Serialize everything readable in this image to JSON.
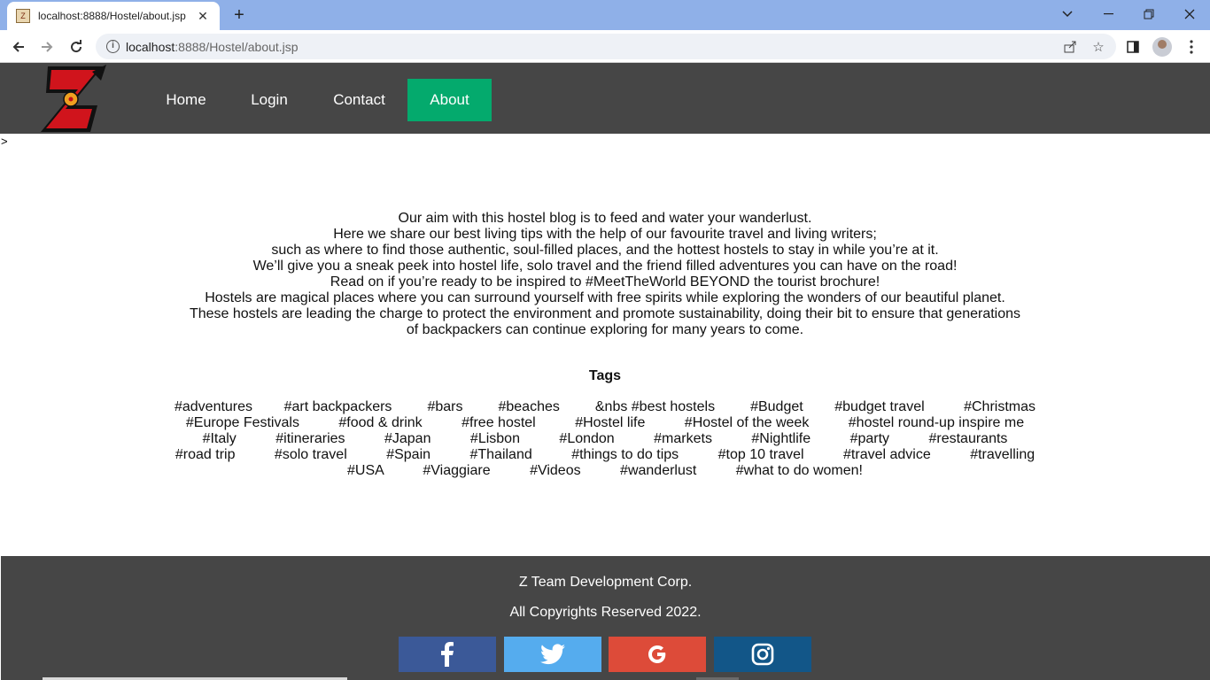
{
  "browser": {
    "tab_title": "localhost:8888/Hostel/about.jsp",
    "url_host": "localhost",
    "url_rest": ":8888/Hostel/about.jsp"
  },
  "site": {
    "nav": [
      {
        "label": "Home"
      },
      {
        "label": "Login"
      },
      {
        "label": "Contact"
      },
      {
        "label": "About",
        "active": true
      }
    ],
    "stray_char": ">"
  },
  "intro": [
    "Our aim with this hostel blog is to feed and water your wanderlust.",
    "Here we share our best living tips with the help of our favourite travel and living writers;",
    "such as where to find those authentic, soul-filled places, and the hottest hostels to stay in while you’re at it.",
    "We’ll give you a sneak peek into hostel life, solo travel and the friend filled adventures you can have on the road!",
    "Read on if you’re ready to be inspired to #MeetTheWorld BEYOND the tourist brochure!",
    "Hostels are magical places where you can surround yourself with free spirits while exploring the wonders of our beautiful planet.",
    "These hostels are leading the charge to protect the environment and promote sustainability, doing their bit to ensure that generations",
    "of backpackers can continue exploring for many years to come."
  ],
  "tags": {
    "title": "Tags",
    "lines": [
      "#adventures        #art backpackers         #bars         #beaches         &nbs #best hostels         #Budget        #budget travel          #Christmas",
      "#Europe Festivals          #food & drink          #free hostel          #Hostel life          #Hostel of the week          #hostel round-up inspire me",
      "#Italy          #itineraries          #Japan          #Lisbon          #London          #markets          #Nightlife          #party          #restaurants",
      "#road trip          #solo travel          #Spain          #Thailand          #things to do tips          #top 10 travel          #travel advice          #travelling",
      "#USA          #Viaggiare          #Videos          #wanderlust          #what to do women!"
    ]
  },
  "footer": {
    "company": "Z Team Development Corp.",
    "copyright": "All Copyrights Reserved 2022.",
    "social": [
      {
        "name": "facebook",
        "color": "#3b5998"
      },
      {
        "name": "twitter",
        "color": "#55acee"
      },
      {
        "name": "google",
        "color": "#dd4b39"
      },
      {
        "name": "instagram",
        "color": "#125688"
      }
    ]
  }
}
